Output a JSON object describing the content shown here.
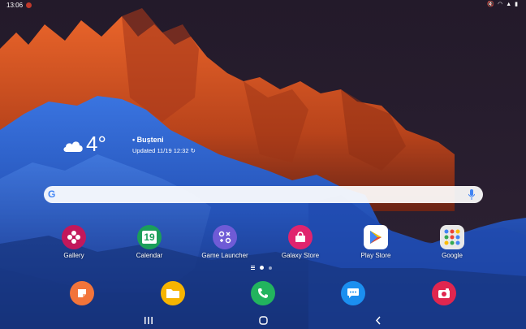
{
  "status": {
    "time": "13:06",
    "icons": [
      "mute-icon",
      "wifi-icon",
      "signal-icon",
      "battery-icon"
    ]
  },
  "weather": {
    "temperature": "4°",
    "location": "Bușteni",
    "updated": "Updated 11/19 12:32"
  },
  "apps": [
    {
      "label": "Gallery",
      "icon": "gallery-icon",
      "color": "#c2185b"
    },
    {
      "label": "Calendar",
      "icon": "calendar-icon",
      "color": "#1b9e5a",
      "day": "19"
    },
    {
      "label": "Game Launcher",
      "icon": "game-launcher-icon",
      "color": "#6f5bd6"
    },
    {
      "label": "Galaxy Store",
      "icon": "galaxy-store-icon",
      "color": "#e0246e"
    },
    {
      "label": "Play Store",
      "icon": "play-store-icon",
      "color": "#ffffff"
    },
    {
      "label": "Google",
      "icon": "google-folder-icon",
      "color": "#e8e8e8"
    }
  ],
  "dock": [
    {
      "icon": "notes-icon",
      "color": "#f2743a"
    },
    {
      "icon": "my-files-icon",
      "color": "#f6b400"
    },
    {
      "icon": "phone-icon",
      "color": "#22b45e"
    },
    {
      "icon": "messages-icon",
      "color": "#1b8ff0"
    },
    {
      "icon": "camera-icon",
      "color": "#e0264f"
    }
  ],
  "colors": {
    "sky": "#2a1f33",
    "orange": "#d9531e",
    "blue": "#2d5cc4",
    "search_bg": "#f3f3f3"
  }
}
